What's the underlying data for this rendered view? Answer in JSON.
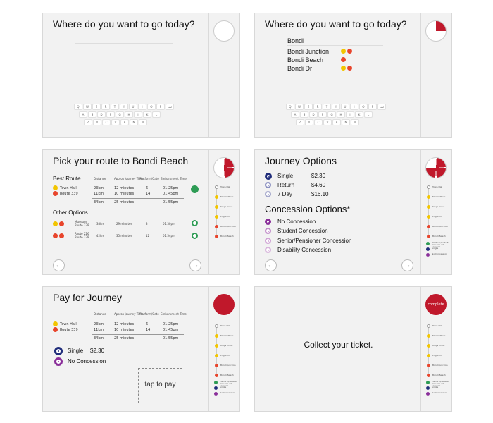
{
  "colors": {
    "accent_red": "#c0182b",
    "yellow": "#f2c500",
    "orange": "#e8452c",
    "navy": "#1f2c7a",
    "purple": "#8a2f9a",
    "green": "#2e9c55",
    "lilac": "#a77fc7",
    "gray": "#888888"
  },
  "screens": [
    {
      "title": "Where do you want to go today?",
      "search_value": "",
      "keyboard": [
        [
          "Q",
          "W",
          "E",
          "R",
          "T",
          "Y",
          "U",
          "I",
          "O",
          "P",
          "⌫"
        ],
        [
          "A",
          "S",
          "D",
          "F",
          "G",
          "H",
          "J",
          "K",
          "L"
        ],
        [
          "Z",
          "X",
          "C",
          "V",
          "B",
          "N",
          "M"
        ]
      ]
    },
    {
      "title": "Where do you want to go today?",
      "search_value": "Bondi",
      "suggestions": [
        "Bondi Junction",
        "Bondi Beach",
        "Bondi Dr"
      ],
      "keyboard": [
        [
          "Q",
          "W",
          "E",
          "R",
          "T",
          "Y",
          "U",
          "I",
          "O",
          "P",
          "⌫"
        ],
        [
          "A",
          "S",
          "D",
          "F",
          "G",
          "H",
          "J",
          "K",
          "L"
        ],
        [
          "Z",
          "X",
          "C",
          "V",
          "B",
          "N",
          "M"
        ]
      ]
    },
    {
      "title": "Pick your route to Bondi Beach",
      "best_route_label": "Best Route",
      "other_options_label": "Other Options",
      "headers": [
        "Distance",
        "Approx Journey Time",
        "Platform/Gate",
        "Embarkment Time"
      ],
      "best": {
        "legs": [
          {
            "name": "Town Hall",
            "dist": "23km",
            "time": "12 minutes",
            "gate": "6",
            "emb": "01.25pm"
          },
          {
            "name": "Route 339",
            "dist": "11km",
            "time": "10 minutes",
            "gate": "14",
            "emb": "01.45pm"
          }
        ],
        "total_dist": "34km",
        "total_time": "25 minutes",
        "total_emb": "01.55pm"
      },
      "others": [
        {
          "name1": "Museum",
          "name2": "Route 339",
          "dist": "38km",
          "time": "29 minutes",
          "gate": "3",
          "emb": "01.30pm"
        },
        {
          "name1": "Route 226",
          "name2": "Route 339",
          "dist": "42km",
          "time": "35 minutes",
          "gate": "12",
          "emb": "01.54pm"
        }
      ]
    },
    {
      "title": "Journey Options",
      "fares": [
        {
          "label": "Single",
          "price": "$2.30"
        },
        {
          "label": "Return",
          "price": "$4.60"
        },
        {
          "label": "7 Day",
          "price": "$16.10"
        }
      ],
      "concession_title": "Concession Options*",
      "concessions": [
        "No Concession",
        "Student Concession",
        "Senior/Pensioner Concession",
        "Disability Concession"
      ]
    },
    {
      "title": "Pay for Journey",
      "headers": [
        "Distance",
        "Approx Journey Time",
        "Platform/Gate",
        "Embarkment Time"
      ],
      "legs": [
        {
          "name": "Town Hall",
          "dist": "23km",
          "time": "12 minutes",
          "gate": "6",
          "emb": "01.25pm"
        },
        {
          "name": "Route 339",
          "dist": "11km",
          "time": "10 minutes",
          "gate": "14",
          "emb": "01.45pm"
        }
      ],
      "total_dist": "34km",
      "total_time": "25 minutes",
      "total_emb": "01.55pm",
      "fare_label": "Single",
      "fare_price": "$2.30",
      "concession": "No Concession",
      "tap_label": "tap to pay"
    },
    {
      "message": "Collect your ticket.",
      "complete_label": "complete"
    }
  ],
  "route_map": {
    "stops": [
      "Town Hall",
      "Martin Place",
      "Kings Cross",
      "Edgecliff",
      "Bondi Junction",
      "Bondi Beach"
    ],
    "legend": [
      "Platform/Gate 6 minutes 12 seconds",
      "Single",
      "No Concession"
    ]
  }
}
